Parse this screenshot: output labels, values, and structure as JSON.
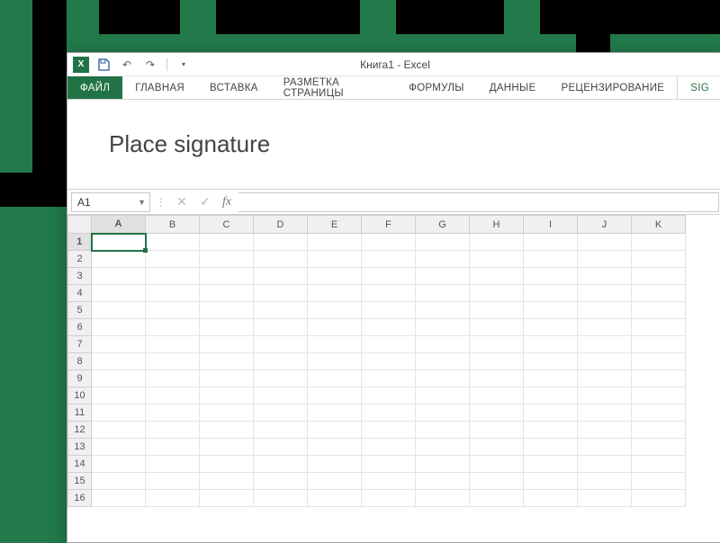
{
  "titlebar": {
    "title": "Книга1 - Excel",
    "app_icon_text": "X"
  },
  "ribbon_tabs": {
    "file": "ФАЙЛ",
    "home": "ГЛАВНАЯ",
    "insert": "ВСТАВКА",
    "pagelayout": "РАЗМЕТКА СТРАНИЦЫ",
    "formulas": "ФОРМУЛЫ",
    "data": "ДАННЫЕ",
    "review": "РЕЦЕНЗИРОВАНИЕ",
    "addin": "SIG"
  },
  "ribbon": {
    "place_signature": "Place signature"
  },
  "formula_bar": {
    "name_box": "A1",
    "fx_label": "fx",
    "formula_value": ""
  },
  "grid": {
    "columns": [
      "A",
      "B",
      "C",
      "D",
      "E",
      "F",
      "G",
      "H",
      "I",
      "J",
      "K"
    ],
    "rows": [
      "1",
      "2",
      "3",
      "4",
      "5",
      "6",
      "7",
      "8",
      "9",
      "10",
      "11",
      "12",
      "13",
      "14",
      "15",
      "16"
    ],
    "selected_col": "A",
    "selected_row": "1"
  }
}
